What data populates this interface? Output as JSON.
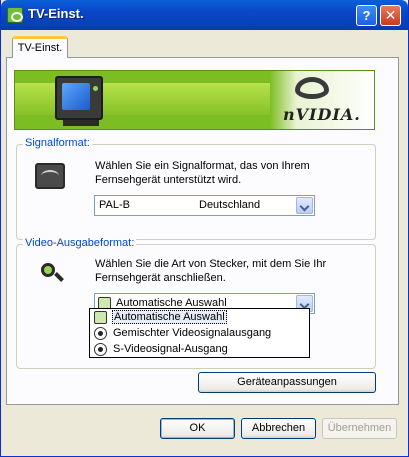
{
  "window": {
    "title": "TV-Einst.",
    "help_glyph": "?",
    "close_glyph": "✕"
  },
  "tabs": [
    {
      "label": "TV-Einst."
    }
  ],
  "banner": {
    "brand": "nVIDIA."
  },
  "signal_format": {
    "group_label": "Signalformat:",
    "description": "Wählen Sie ein Signalformat, das von Ihrem Fernsehgerät unterstützt wird.",
    "selected_format": "PAL-B",
    "selected_country": "Deutschland"
  },
  "video_output": {
    "group_label": "Video-Ausgabeformat:",
    "description": "Wählen Sie die Art von Stecker, mit dem Sie Ihr Fernsehgerät anschließen.",
    "selected": "Automatische Auswahl",
    "options": [
      {
        "label": "Automatische Auswahl",
        "icon": "check-icon"
      },
      {
        "label": "Gemischter Videosignalausgang",
        "icon": "composite-icon"
      },
      {
        "label": "S-Videosignal-Ausgang",
        "icon": "svideo-icon"
      }
    ]
  },
  "buttons": {
    "adjust": "Geräteanpassungen",
    "ok": "OK",
    "cancel": "Abbrechen",
    "apply": "Übernehmen"
  },
  "colors": {
    "accent": "#0046d5",
    "banner_green": "#7dbd24",
    "titlebar": "#0a46c8"
  }
}
